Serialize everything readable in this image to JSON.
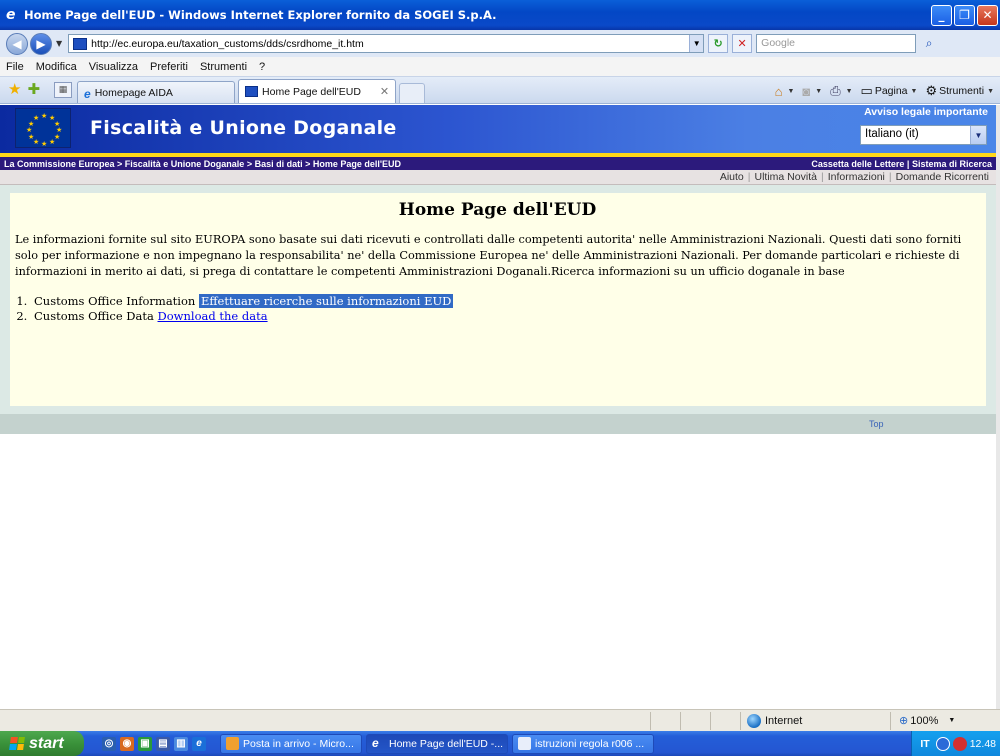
{
  "window": {
    "title": "Home Page dell'EUD - Windows Internet Explorer fornito da SOGEI S.p.A."
  },
  "address_bar": {
    "url": "http://ec.europa.eu/taxation_customs/dds/csrdhome_it.htm",
    "search_placeholder": "Google"
  },
  "menu": [
    "File",
    "Modifica",
    "Visualizza",
    "Preferiti",
    "Strumenti",
    "?"
  ],
  "tabs": [
    {
      "label": "Homepage AIDA",
      "active": false
    },
    {
      "label": "Home Page dell'EUD",
      "active": true
    }
  ],
  "command_bar": {
    "page_label": "Pagina",
    "tools_label": "Strumenti"
  },
  "site": {
    "title": "Fiscalità e Unione Doganale",
    "legal_notice": "Avviso legale importante",
    "language": "Italiano (it)",
    "breadcrumb": "La Commissione Europea > Fiscalità e Unione Doganale > Basi di dati > Home Page dell'EUD",
    "top_links": "Cassetta delle Lettere | Sistema di Ricerca",
    "util_links": [
      "Aiuto",
      "Ultima Novità",
      "Informazioni",
      "Domande Ricorrenti"
    ],
    "top_link": "Top"
  },
  "content": {
    "heading": "Home Page dell'EUD",
    "paragraph": "Le informazioni fornite sul sito EUROPA sono basate sui dati ricevuti e controllati dalle competenti autorita' nelle Amministrazioni Nazionali. Questi dati sono forniti solo per informazione e non impegnano la responsabilita' ne' della Commissione Europea ne' delle Amministrazioni Nazionali. Per domande particolari e richieste di informazioni in merito ai dati, si prega di contattare le competenti Amministrazioni Doganali.Ricerca informazioni su un ufficio doganale in base",
    "items": [
      {
        "text": "Customs Office Information",
        "link": "Effettuare ricerche sulle informazioni EUD"
      },
      {
        "text": "Customs Office Data",
        "link": "Download the data"
      }
    ]
  },
  "status_bar": {
    "zone": "Internet",
    "zoom": "100%"
  },
  "taskbar": {
    "start": "start",
    "tasks": [
      {
        "label": "Posta in arrivo - Micro..."
      },
      {
        "label": "Home Page dell'EUD -..."
      },
      {
        "label": "istruzioni regola r006 ..."
      }
    ],
    "language": "IT",
    "clock": "12.48"
  }
}
